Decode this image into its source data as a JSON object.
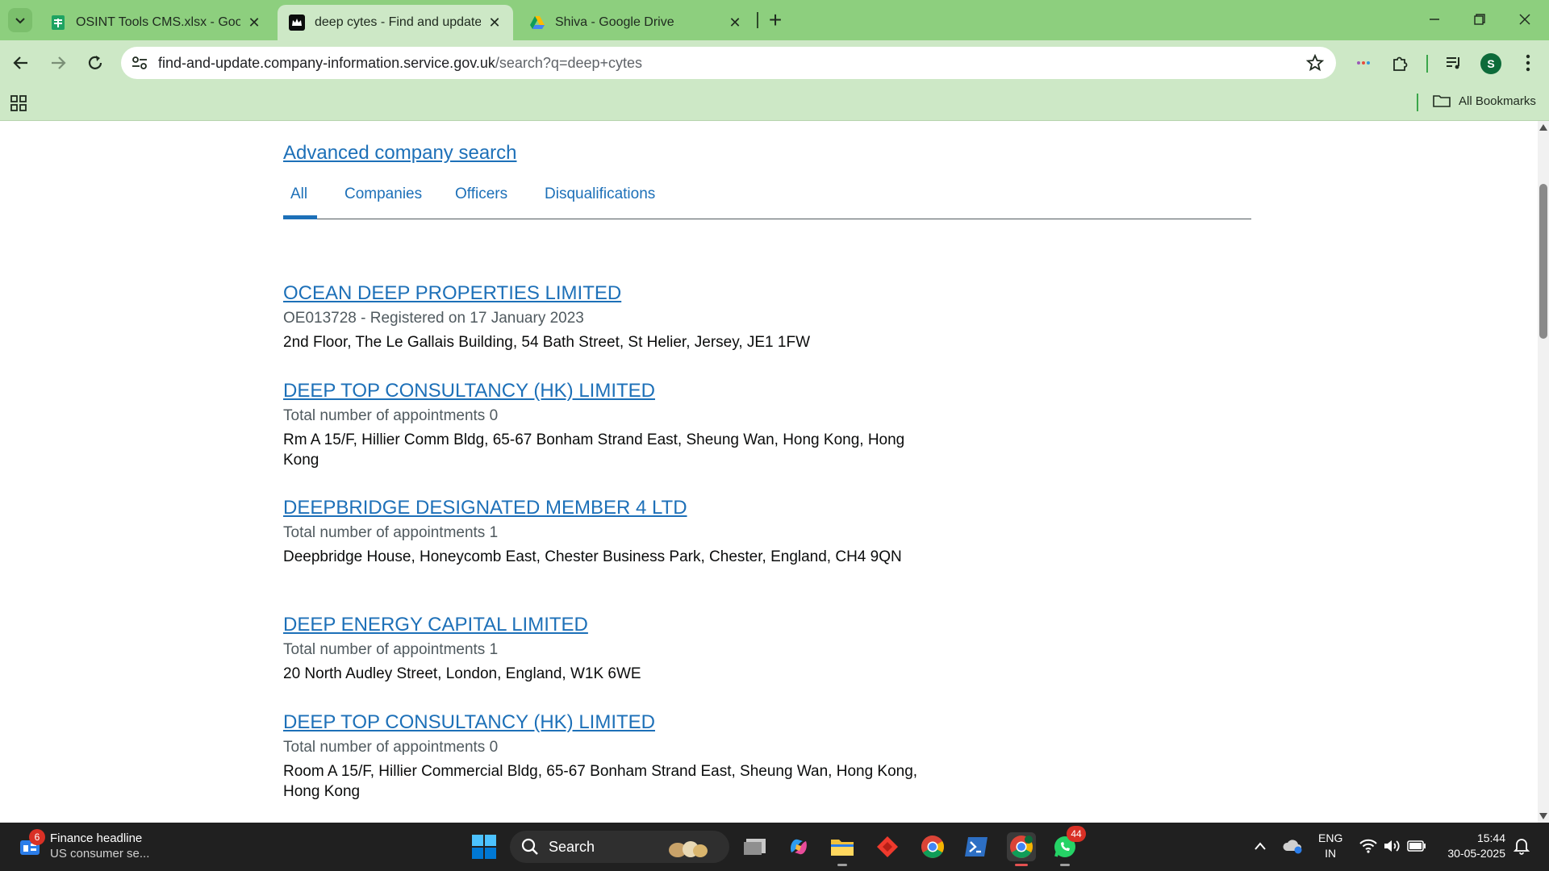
{
  "browser": {
    "tabs": [
      {
        "title": "OSINT Tools CMS.xlsx - Google",
        "icon": "sheets-icon"
      },
      {
        "title": "deep cytes - Find and update co",
        "icon": "crown-icon",
        "active": true
      },
      {
        "title": "Shiva - Google Drive",
        "icon": "drive-icon"
      }
    ],
    "url_host": "find-and-update.company-information.service.gov.uk",
    "url_path": "/search?q=deep+cytes",
    "profile_initial": "S",
    "bookmarks_label": "All Bookmarks"
  },
  "page": {
    "advanced_search": "Advanced company search",
    "tabs": [
      "All",
      "Companies",
      "Officers",
      "Disqualifications"
    ],
    "results": [
      {
        "title": "OCEAN DEEP PROPERTIES LIMITED",
        "meta": "OE013728 - Registered on 17 January 2023",
        "address": "2nd Floor, The Le Gallais Building, 54 Bath Street, St Helier, Jersey, JE1 1FW"
      },
      {
        "title": "DEEP TOP CONSULTANCY (HK) LIMITED",
        "meta": "Total number of appointments 0",
        "address": "Rm A 15/F, Hillier Comm Bldg, 65-67 Bonham Strand East, Sheung Wan, Hong Kong, Hong Kong"
      },
      {
        "title": "DEEPBRIDGE DESIGNATED MEMBER 4 LTD",
        "meta": "Total number of appointments 1",
        "address": "Deepbridge House, Honeycomb East, Chester Business Park, Chester, England, CH4 9QN"
      },
      {
        "title": "DEEP ENERGY CAPITAL LIMITED",
        "meta": "Total number of appointments 1",
        "address": "20 North Audley Street, London, England, W1K 6WE"
      },
      {
        "title": "DEEP TOP CONSULTANCY (HK) LIMITED",
        "meta": "Total number of appointments 0",
        "address": "Room A 15/F, Hillier Commercial Bldg, 65-67 Bonham Strand East, Sheung Wan, Hong Kong, Hong Kong"
      }
    ]
  },
  "taskbar": {
    "news_badge": "6",
    "news_headline": "Finance headline",
    "news_sub": "US consumer se...",
    "search_label": "Search",
    "whatsapp_badge": "44",
    "lang_top": "ENG",
    "lang_bottom": "IN",
    "time": "15:44",
    "date": "30-05-2025"
  },
  "colors": {
    "chrome_frame": "#8dcf7e",
    "chrome_toolbar": "#cde8c6",
    "link_blue": "#1d70b8",
    "meta_grey": "#505a5f",
    "taskbar": "#202020"
  }
}
